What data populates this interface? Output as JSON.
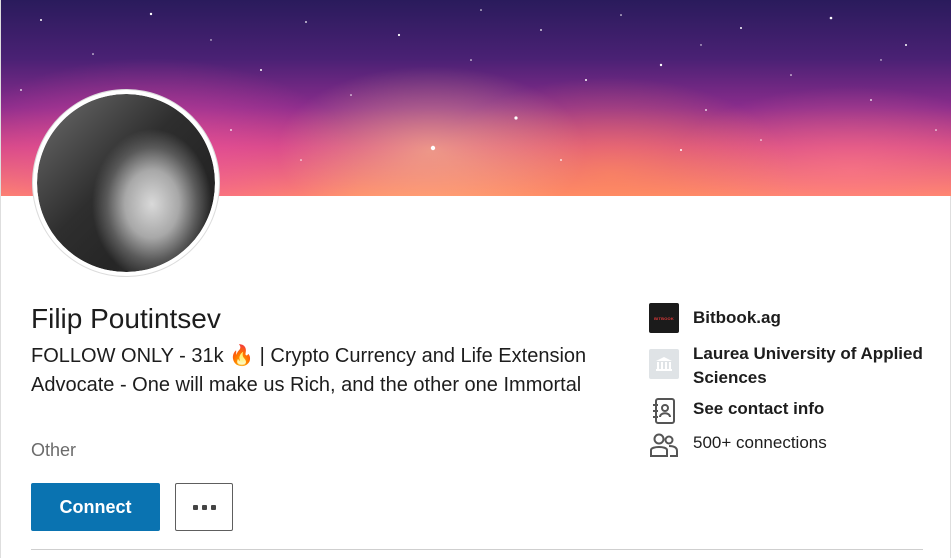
{
  "profile": {
    "name": "Filip Poutintsev",
    "headline": "FOLLOW ONLY - 31k 🔥 | Crypto Currency and Life Extension Advocate - One will make us Rich, and the other one Immortal",
    "location": "Other"
  },
  "actions": {
    "connect_label": "Connect",
    "more_label": "More actions"
  },
  "sidebar": {
    "company": "Bitbook.ag",
    "company_logo_text": "BITBOOK",
    "school": "Laurea University of Applied Sciences",
    "contact": "See contact info",
    "connections": "500+ connections"
  },
  "colors": {
    "primary_button": "#0a73b1",
    "text": "#1d1d1d",
    "muted": "#6b6b6b"
  },
  "icons": {
    "company": "bitbook-logo",
    "school": "school-building-icon",
    "contact": "contact-book-icon",
    "connections": "people-icon",
    "more": "ellipsis-icon"
  }
}
